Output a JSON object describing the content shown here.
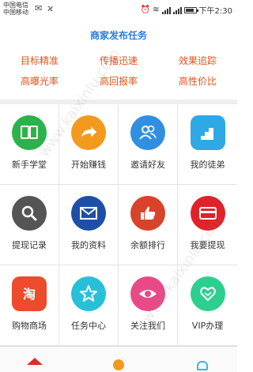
{
  "status_bar": {
    "carrier_1": "中国电信",
    "carrier_2": "中国移动",
    "time": "下午2:30"
  },
  "header": {
    "title": "商家发布任务",
    "features": [
      "目标精准",
      "传播迅速",
      "效果追踪",
      "高曝光率",
      "高回报率",
      "高性价比"
    ]
  },
  "grid": [
    {
      "label": "新手学堂",
      "icon": "book-icon",
      "color": "#2cb24a"
    },
    {
      "label": "开始赚钱",
      "icon": "arrow-right-icon",
      "color": "#f39a1e"
    },
    {
      "label": "邀请好友",
      "icon": "people-icon",
      "color": "#2f8fe0"
    },
    {
      "label": "我的徒弟",
      "icon": "stairs-icon",
      "color": "#2fa8e6"
    },
    {
      "label": "提现记录",
      "icon": "magnifier-icon",
      "color": "#555555"
    },
    {
      "label": "我的资料",
      "icon": "envelope-icon",
      "color": "#1e4fa8"
    },
    {
      "label": "余额排行",
      "icon": "thumbs-up-icon",
      "color": "#d9432b"
    },
    {
      "label": "我要提现",
      "icon": "card-icon",
      "color": "#e0222b"
    },
    {
      "label": "购物商场",
      "icon": "taobao-icon",
      "color": "#ee4a2c"
    },
    {
      "label": "任务中心",
      "icon": "star-icon",
      "color": "#28c0d8"
    },
    {
      "label": "关注我们",
      "icon": "eye-icon",
      "color": "#e84a88"
    },
    {
      "label": "VIP办理",
      "icon": "handshake-icon",
      "color": "#2ccf8e"
    }
  ],
  "watermark": "www.kaixinlu.com"
}
